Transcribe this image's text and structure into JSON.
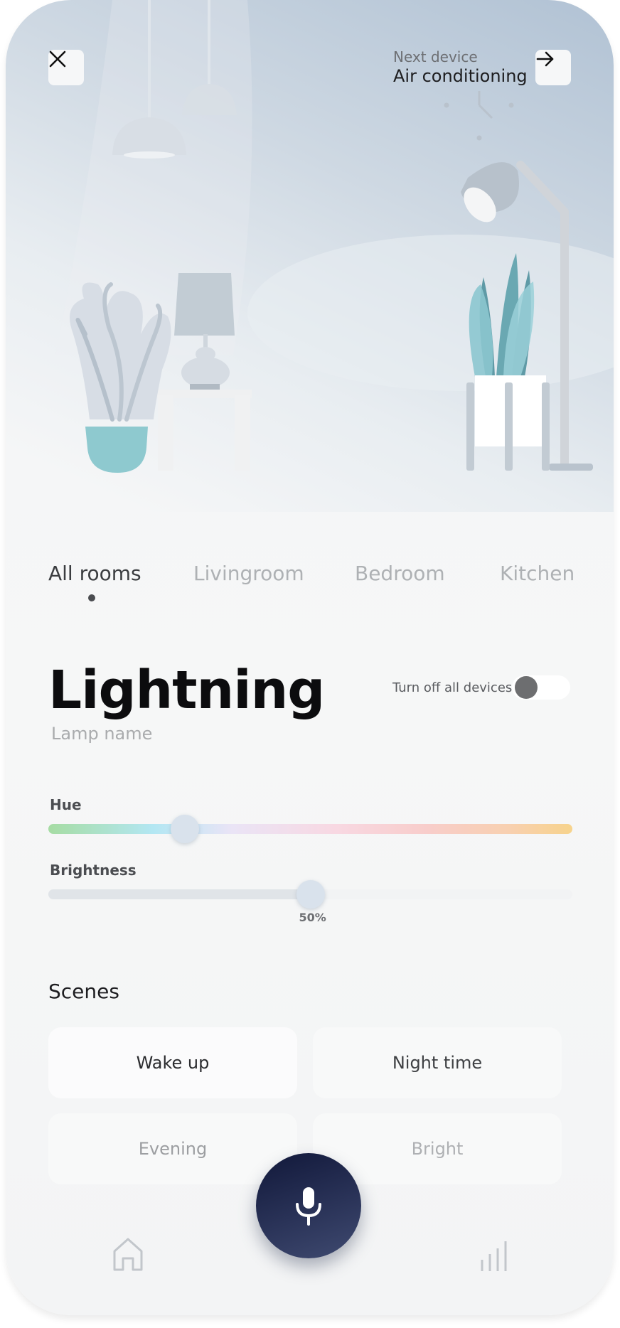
{
  "header": {
    "next_device_label": "Next device",
    "next_device_name": "Air conditioning"
  },
  "tabs": [
    {
      "label": "All rooms",
      "active": true
    },
    {
      "label": "Livingroom",
      "active": false
    },
    {
      "label": "Bedroom",
      "active": false
    },
    {
      "label": "Kitchen",
      "active": false
    }
  ],
  "device": {
    "title": "Lightning",
    "subtitle": "Lamp name",
    "toggle_label": "Turn off all devices",
    "toggle_on": false
  },
  "hue": {
    "label": "Hue",
    "position": 0.26
  },
  "brightness": {
    "label": "Brightness",
    "value": 50,
    "value_label": "50%"
  },
  "scenes": {
    "title": "Scenes",
    "items": [
      "Wake up",
      "Night time",
      "Evening",
      "Bright"
    ]
  },
  "icons": {
    "close": "close-icon",
    "next": "arrow-right-icon",
    "mic": "microphone-icon",
    "home": "home-icon",
    "stats": "bar-chart-icon"
  },
  "colors": {
    "accent_dark": "#1b2344",
    "plant_teal": "#8ec9cf",
    "active_tab": "#3b3d40",
    "inactive_tab": "#aeb1b4"
  }
}
